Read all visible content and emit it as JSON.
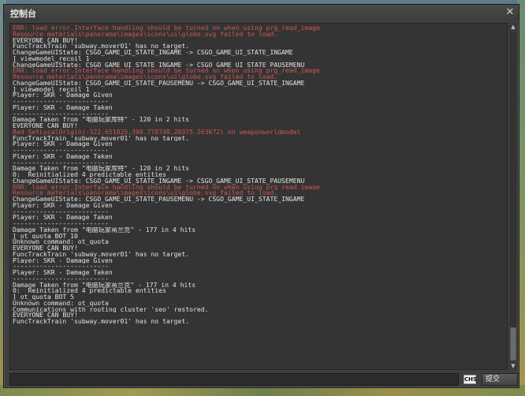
{
  "window": {
    "title": "控制台",
    "close_glyph": "✕"
  },
  "log_lines": [
    {
      "text": "ERR: load error.Interface handling should be turned on when using prg_read_image",
      "color": "error"
    },
    {
      "text": "Resource materials\\panorama\\images\\icons\\ui\\globe.svg failed to load.",
      "color": "error"
    },
    {
      "text": "EVERYONE CAN BUY!",
      "color": "normal"
    },
    {
      "text": "FuncTrackTrain 'subway.mover01' has no target.",
      "color": "normal"
    },
    {
      "text": "ChangeGameUIState: CSGO_GAME_UI_STATE_INGAME -> CSGO_GAME_UI_STATE_INGAME",
      "color": "normal"
    },
    {
      "text": "] viewmodel_recoil 1",
      "color": "normal"
    },
    {
      "text": "ChangeGameUIState: CSGO_GAME_UI_STATE_INGAME -> CSGO_GAME_UI_STATE_PAUSEMENU",
      "color": "normal"
    },
    {
      "text": "ERR: load error.Interface handling should be turned on when using prg_read_image",
      "color": "error"
    },
    {
      "text": "Resource materials\\panorama\\images\\icons\\ui\\globe.svg failed to load.",
      "color": "error"
    },
    {
      "text": "ChangeGameUIState: CSGO_GAME_UI_STATE_PAUSEMENU -> CSGO_GAME_UI_STATE_INGAME",
      "color": "normal"
    },
    {
      "text": "] viewmodel_recoil 1",
      "color": "normal"
    },
    {
      "text": "Player: SKR - Damage Given",
      "color": "normal"
    },
    {
      "text": "-------------------------",
      "color": "normal"
    },
    {
      "text": "Player: SKR - Damage Taken",
      "color": "normal"
    },
    {
      "text": "-------------------------",
      "color": "normal"
    },
    {
      "text": "Damage Taken from \"电脑玩家库特\" - 120 in 2 hits",
      "color": "normal"
    },
    {
      "text": "EVERYONE CAN BUY!",
      "color": "normal"
    },
    {
      "text": "Bad SetLocalOrigin(-322.651825,390.778748,20375.263672) on weaponworldmodel",
      "color": "error"
    },
    {
      "text": "FuncTrackTrain 'subway.mover01' has no target.",
      "color": "normal"
    },
    {
      "text": "Player: SKR - Damage Given",
      "color": "normal"
    },
    {
      "text": "-------------------------",
      "color": "normal"
    },
    {
      "text": "Player: SKR - Damage Taken",
      "color": "normal"
    },
    {
      "text": "-------------------------",
      "color": "normal"
    },
    {
      "text": "Damage Taken from \"电脑玩家库特\" - 120 in 2 hits",
      "color": "normal"
    },
    {
      "text": "0:  Reinitialized 4 predictable entities",
      "color": "normal"
    },
    {
      "text": "ChangeGameUIState: CSGO_GAME_UI_STATE_INGAME -> CSGO_GAME_UI_STATE_PAUSEMENU",
      "color": "normal"
    },
    {
      "text": "ERR: load error.Interface handling should be turned on when using prg_read_image",
      "color": "error"
    },
    {
      "text": "Resource materials\\panorama\\images\\icons\\ui\\globe.svg failed to load.",
      "color": "error"
    },
    {
      "text": "ChangeGameUIState: CSGO_GAME_UI_STATE_PAUSEMENU -> CSGO_GAME_UI_STATE_INGAME",
      "color": "normal"
    },
    {
      "text": "Player: SKR - Damage Given",
      "color": "normal"
    },
    {
      "text": "-------------------------",
      "color": "normal"
    },
    {
      "text": "Player: SKR - Damage Taken",
      "color": "normal"
    },
    {
      "text": "-------------------------",
      "color": "normal"
    },
    {
      "text": "Damage Taken from \"电脑玩家蒋兰克\" - 177 in 4 hits",
      "color": "normal"
    },
    {
      "text": "] ot_quota BOT 10",
      "color": "normal"
    },
    {
      "text": "Unknown command: ot_quota",
      "color": "normal"
    },
    {
      "text": "EVERYONE CAN BUY!",
      "color": "normal"
    },
    {
      "text": "FuncTrackTrain 'subway.mover01' has no target.",
      "color": "normal"
    },
    {
      "text": "Player: SKR - Damage Given",
      "color": "normal"
    },
    {
      "text": "-------------------------",
      "color": "normal"
    },
    {
      "text": "Player: SKR - Damage Taken",
      "color": "normal"
    },
    {
      "text": "-------------------------",
      "color": "normal"
    },
    {
      "text": "Damage Taken from \"电脑玩家蒋兰克\" - 177 in 4 hits",
      "color": "normal"
    },
    {
      "text": "0:  Reinitialized 4 predictable entities",
      "color": "normal"
    },
    {
      "text": "] ot_quota BOT 5",
      "color": "normal"
    },
    {
      "text": "Unknown command: ot_quota",
      "color": "normal"
    },
    {
      "text": "Communications with routing cluster 'seo' restored.",
      "color": "normal"
    },
    {
      "text": "EVERYONE CAN BUY!",
      "color": "normal"
    },
    {
      "text": "FuncTrackTrain 'subway.mover01' has no target.",
      "color": "normal"
    }
  ],
  "scrollbar": {
    "up_glyph": "▲",
    "down_glyph": "▼",
    "thumb_start_fraction": 0.9,
    "thumb_size_fraction": 0.1
  },
  "input": {
    "value": "",
    "placeholder": ""
  },
  "ime_indicator": "CHS",
  "submit_label": "提交",
  "colors": {
    "normal_text": "#e2e2e2",
    "error_text": "#cf5555",
    "window_bg": "#3e3e3e",
    "log_bg": "#343434"
  }
}
